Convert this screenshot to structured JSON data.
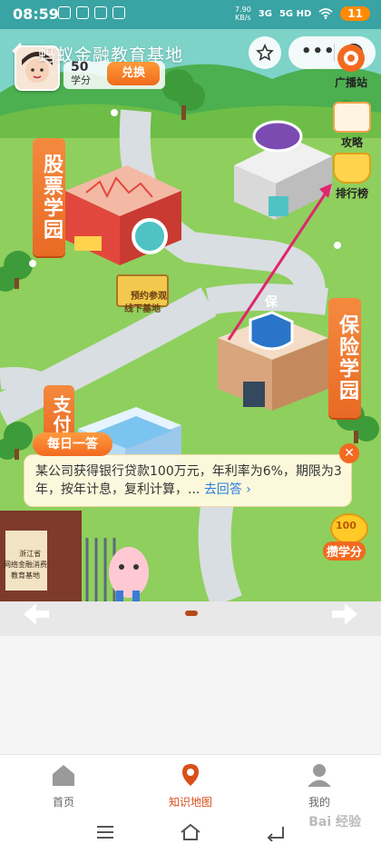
{
  "status": {
    "time": "08:59",
    "net_speed": "7.90\nKB/s",
    "signal_3g": "3G",
    "signal_5g": "5G HD",
    "battery": "11"
  },
  "header": {
    "title": "蚂蚁金融教育基地",
    "points_value": "50",
    "points_label": "学分",
    "exchange_label": "兑换",
    "broadcast_label": "广播站"
  },
  "side": {
    "guide_label": "攻略",
    "ranking_label": "排行榜"
  },
  "map": {
    "stock_campus": "股票学园",
    "insurance_campus": "保险学园",
    "pay_campus": "支付",
    "visit_sign": "预约参观\n线下基地",
    "gate_plaque": "浙江省\n网络金融消费\n教育基地",
    "insurance_badge": "保"
  },
  "daily": {
    "tag": "每日一答",
    "question": "某公司获得银行贷款100万元，年利率为6%，期限为3年，按年计息，复利计算，...",
    "answer_link": "去回答 ›"
  },
  "earn": {
    "badge": "100",
    "label": "攒学分"
  },
  "tabs": [
    {
      "label": "首页",
      "active": false
    },
    {
      "label": "知识地图",
      "active": true
    },
    {
      "label": "我的",
      "active": false
    }
  ],
  "watermark": "Bai 经验",
  "colors": {
    "accent": "#f26a20",
    "grass": "#8fcf5d",
    "road": "#d9dee2"
  }
}
